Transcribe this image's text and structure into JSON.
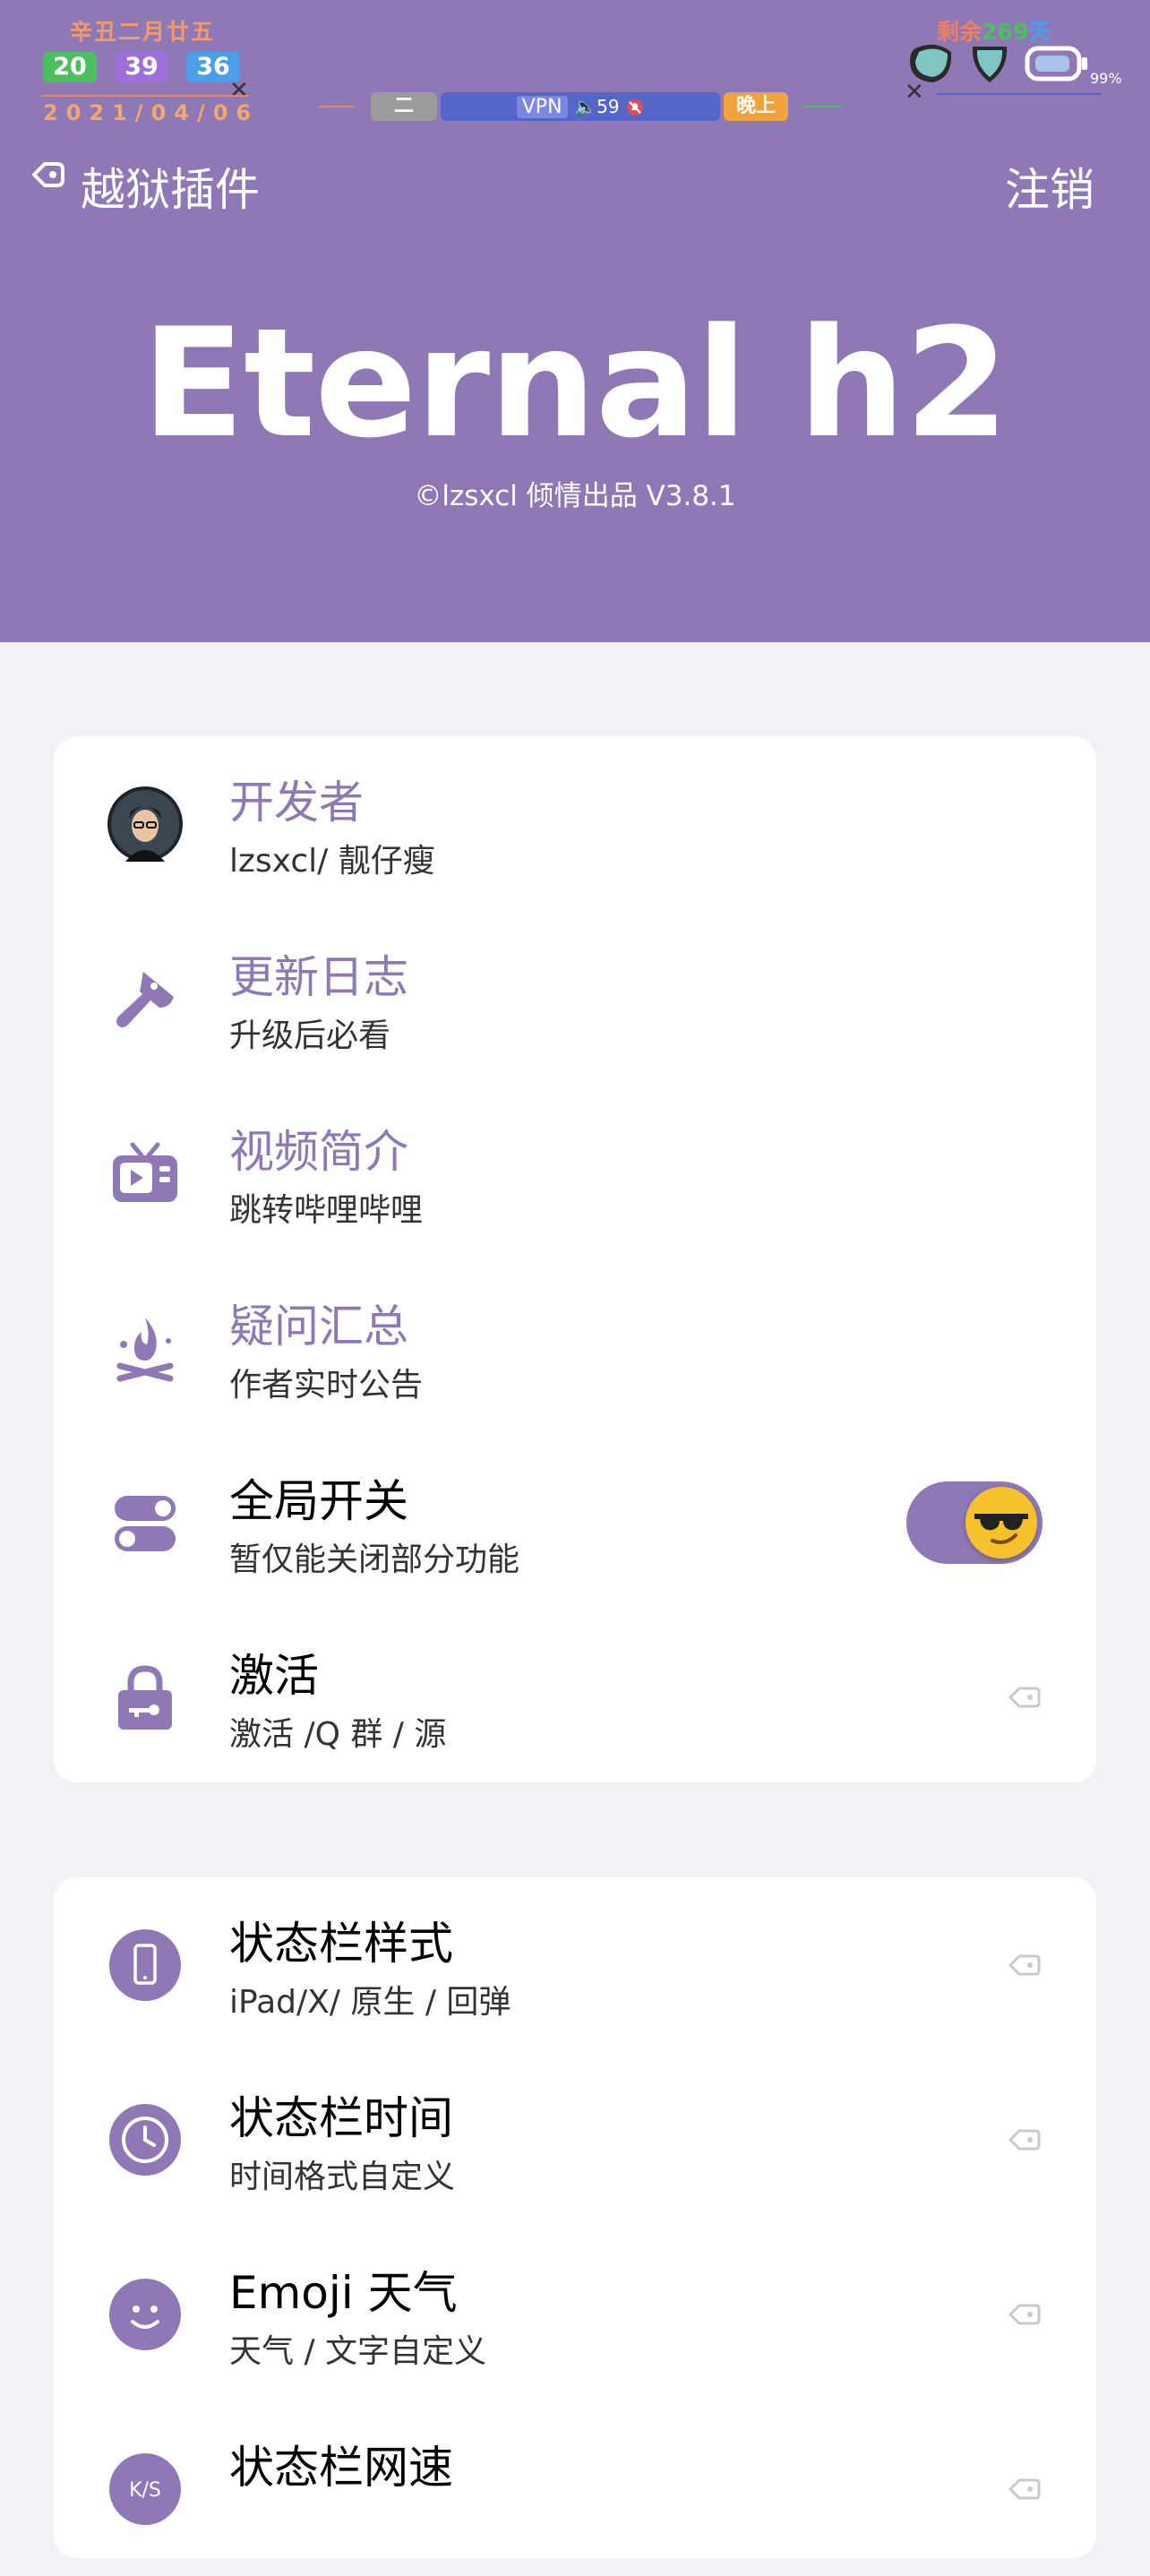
{
  "status": {
    "lunar": "辛丑二月廿五",
    "counters": [
      "20",
      "39",
      "36"
    ],
    "date": "2021/04/06",
    "weekday": "二",
    "vpn": "VPN",
    "volume": "🔈59",
    "mute_icon": "bell-off",
    "period": "晚上",
    "remaining_prefix": "剩余",
    "remaining_days": "269",
    "remaining_suffix": "天",
    "battery_percent": "99%",
    "colors": {
      "green": "#4cbf5e",
      "purple": "#9d6fd8",
      "blue": "#4a9fea",
      "orange": "#f2a23c",
      "vpnbar": "#5666c8",
      "gray": "#9b9b9b"
    }
  },
  "nav": {
    "back_label": "越狱插件",
    "logout_label": "注销"
  },
  "hero": {
    "title": "Eternal h2",
    "subtitle": "©lzsxcl 倾情出品 V3.8.1"
  },
  "accent_color": "#8e78b6",
  "card1": [
    {
      "icon": "avatar",
      "title": "开发者",
      "subtitle": "lzsxcl/ 靓仔瘦",
      "accent": true
    },
    {
      "icon": "cleaver-icon",
      "title": "更新日志",
      "subtitle": "升级后必看",
      "accent": true
    },
    {
      "icon": "tv-icon",
      "title": "视频简介",
      "subtitle": "跳转哔哩哔哩",
      "accent": true
    },
    {
      "icon": "campfire-icon",
      "title": "疑问汇总",
      "subtitle": "作者实时公告",
      "accent": true
    },
    {
      "icon": "toggles-icon",
      "title": "全局开关",
      "subtitle": "暂仅能关闭部分功能",
      "accent": false,
      "toggle_on": true
    },
    {
      "icon": "lock-icon",
      "title": "激活",
      "subtitle": "激活 /Q 群 / 源",
      "accent": false
    }
  ],
  "card2": [
    {
      "icon": "phone-icon",
      "title": "状态栏样式",
      "subtitle": "iPad/X/ 原生 / 回弹"
    },
    {
      "icon": "clock-icon",
      "title": "状态栏时间",
      "subtitle": "时间格式自定义"
    },
    {
      "icon": "smile-icon",
      "title": "Emoji 天气",
      "subtitle": "天气 / 文字自定义"
    },
    {
      "icon": "speed-icon",
      "title": "状态栏网速",
      "subtitle": ""
    }
  ]
}
